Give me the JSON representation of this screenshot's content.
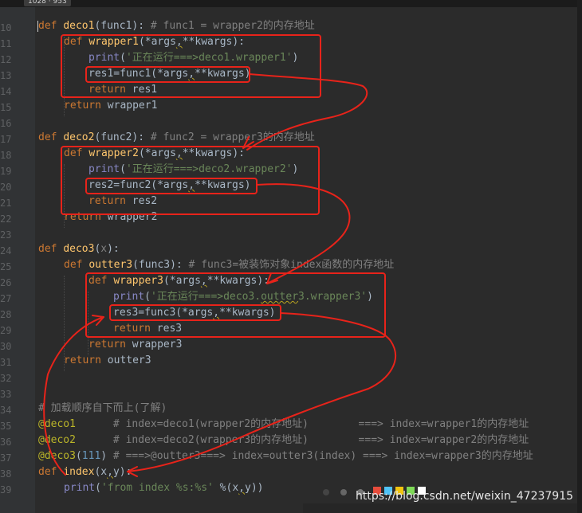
{
  "top_bar": {
    "dimensions": "1028 · 953"
  },
  "gutter_numbers": [
    "10",
    "11",
    "12",
    "13",
    "14",
    "15",
    "16",
    "17",
    "18",
    "19",
    "20",
    "21",
    "22",
    "23",
    "24",
    "25",
    "26",
    "27",
    "28",
    "29",
    "30",
    "31",
    "32",
    "33",
    "34",
    "35",
    "36",
    "37",
    "38",
    "39"
  ],
  "code": {
    "l10": {
      "kw": "def ",
      "name": "deco1",
      "args": "(func1):",
      "comment": " # func1 = wrapper2的内存地址"
    },
    "l11": {
      "kw": "def ",
      "name": "wrapper1",
      "args": "(*args",
      "sep": ",",
      "rest": "**kwargs):"
    },
    "l12": {
      "bi": "print",
      "open": "(",
      "str": "'正在运行===>deco1.wrapper1'",
      "close": ")"
    },
    "l13": {
      "a": "res1=func1(*args",
      "sep": ",",
      "b": "**kwargs)"
    },
    "l14": {
      "kw": "return ",
      "val": "res1"
    },
    "l15": {
      "kw": "return ",
      "val": "wrapper1"
    },
    "l17": {
      "kw": "def ",
      "name": "deco2",
      "args": "(func2):",
      "comment": " # func2 = wrapper3的内存地址"
    },
    "l18": {
      "kw": "def ",
      "name": "wrapper2",
      "args": "(*args",
      "sep": ",",
      "rest": "**kwargs):"
    },
    "l19": {
      "bi": "print",
      "open": "(",
      "str": "'正在运行===>deco2.wrapper2'",
      "close": ")"
    },
    "l20": {
      "a": "res2=func2(*args",
      "sep": ",",
      "b": "**kwargs)"
    },
    "l21": {
      "kw": "return ",
      "val": "res2"
    },
    "l22": {
      "kw": "return ",
      "val": "wrapper2"
    },
    "l24": {
      "kw": "def ",
      "name": "deco3",
      "open": "(",
      "param": "x",
      "close": "):"
    },
    "l25": {
      "kw": "def ",
      "name": "outter3",
      "args": "(func3):",
      "comment": " # func3=被装饰对象index函数的内存地址"
    },
    "l26": {
      "kw": "def ",
      "name": "wrapper3",
      "args": "(*args",
      "sep": ",",
      "rest": "**kwargs):"
    },
    "l27": {
      "bi": "print",
      "open": "(",
      "str1": "'正在运行===>deco3.",
      "str2": "outter",
      "str3": "3.wrapper3'",
      "close": ")"
    },
    "l28": {
      "a": "res3=func3(*args",
      "sep": ",",
      "b": "**kwargs)"
    },
    "l29": {
      "kw": "return ",
      "val": "res3"
    },
    "l30": {
      "kw": "return ",
      "val": "wrapper3"
    },
    "l31": {
      "kw": "return ",
      "val": "outter3"
    },
    "l34": {
      "comment": "# 加载顺序自下而上(了解)"
    },
    "l35": {
      "dec": "@deco1",
      "comment": "      # index=deco1(wrapper2的内存地址)        ===> index=wrapper1的内存地址"
    },
    "l36": {
      "dec": "@deco2",
      "comment": "      # index=deco2(wrapper3的内存地址)        ===> index=wrapper2的内存地址"
    },
    "l37": {
      "dec": "@deco3",
      "open": "(",
      "num": "111",
      "close": ")",
      "comment": " # ===>@outter3===> index=outter3(index) ===> index=wrapper3的内存地址"
    },
    "l38": {
      "kw": "def ",
      "name": "index",
      "open": "(x",
      "sep": ",",
      "close": "y):"
    },
    "l39": {
      "bi": "print",
      "open": "(",
      "str": "'from index %s:%s'",
      "mid": " %(x",
      "sep": ",",
      "close": "y))"
    }
  },
  "annotation_color": "#e8231a",
  "watermark": "https://blog.csdn.net/weixin_47237915",
  "toolbar_colors": [
    "#e74c3c",
    "#4fc3f7",
    "#f1c40f",
    "#7ed957",
    "#ffffff"
  ]
}
